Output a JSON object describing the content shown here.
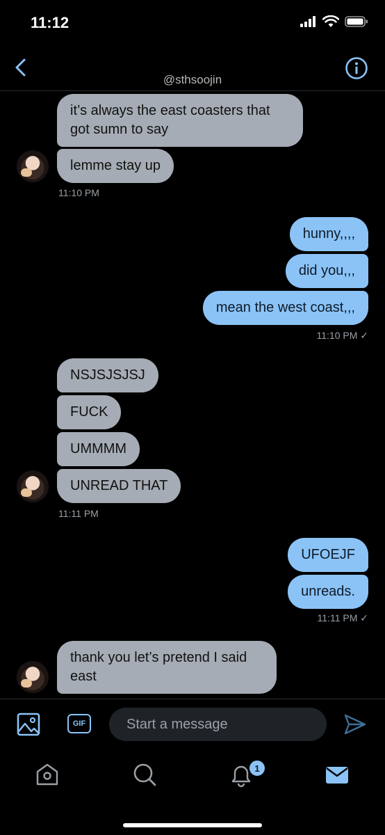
{
  "status_bar": {
    "time": "11:12"
  },
  "header": {
    "handle": "@sthsoojin"
  },
  "messages": {
    "g1": {
      "m1": "it’s always the east coasters that got sumn to say",
      "m2": "lemme stay up",
      "time": "11:10 PM"
    },
    "g2": {
      "m1": "hunny,,,,",
      "m2": "did you,,,",
      "m3": "mean the west coast,,,",
      "time": "11:10 PM ✓"
    },
    "g3": {
      "m1": "NSJSJSJSJ",
      "m2": "FUCK",
      "m3": "UMMMM",
      "m4": "UNREAD THAT",
      "time": "11:11 PM"
    },
    "g4": {
      "m1": "UFOEJF",
      "m2": "unreads.",
      "time": "11:11 PM ✓"
    },
    "g5": {
      "m1": "thank you let’s pretend I said east"
    }
  },
  "composer": {
    "placeholder": "Start a message",
    "gif_label": "GIF"
  },
  "tabbar": {
    "notification_count": "1"
  },
  "colors": {
    "accent": "#8bc3f6",
    "received_bubble": "#a6acb5",
    "background": "#000000"
  }
}
